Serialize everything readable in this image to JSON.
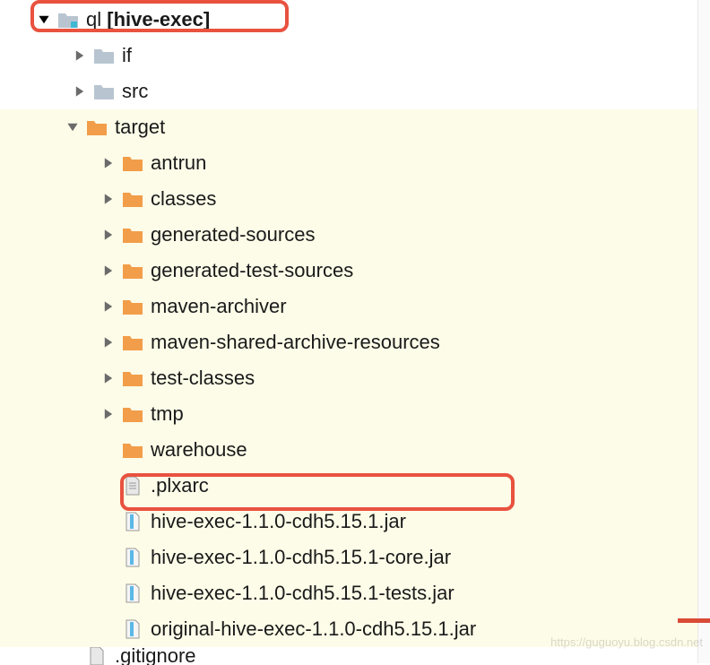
{
  "tree": {
    "root": {
      "name": "ql",
      "suffix": "[hive-exec]",
      "children": [
        {
          "name": "if",
          "icon": "folder-gray",
          "expandable": true
        },
        {
          "name": "src",
          "icon": "folder-gray",
          "expandable": true
        },
        {
          "name": "target",
          "icon": "folder-orange",
          "expanded": true,
          "children": [
            {
              "name": "antrun",
              "icon": "folder-orange",
              "expandable": true
            },
            {
              "name": "classes",
              "icon": "folder-orange",
              "expandable": true
            },
            {
              "name": "generated-sources",
              "icon": "folder-orange",
              "expandable": true
            },
            {
              "name": "generated-test-sources",
              "icon": "folder-orange",
              "expandable": true
            },
            {
              "name": "maven-archiver",
              "icon": "folder-orange",
              "expandable": true
            },
            {
              "name": "maven-shared-archive-resources",
              "icon": "folder-orange",
              "expandable": true
            },
            {
              "name": "test-classes",
              "icon": "folder-orange",
              "expandable": true
            },
            {
              "name": "tmp",
              "icon": "folder-orange",
              "expandable": true
            },
            {
              "name": "warehouse",
              "icon": "folder-orange",
              "expandable": false
            },
            {
              "name": ".plxarc",
              "icon": "file-text",
              "expandable": false
            },
            {
              "name": "hive-exec-1.1.0-cdh5.15.1.jar",
              "icon": "file-archive",
              "expandable": false
            },
            {
              "name": "hive-exec-1.1.0-cdh5.15.1-core.jar",
              "icon": "file-archive",
              "expandable": false
            },
            {
              "name": "hive-exec-1.1.0-cdh5.15.1-tests.jar",
              "icon": "file-archive",
              "expandable": false
            },
            {
              "name": "original-hive-exec-1.1.0-cdh5.15.1.jar",
              "icon": "file-archive",
              "expandable": false
            }
          ]
        },
        {
          "name": ".gitignore",
          "icon": "file-text",
          "expandable": false
        }
      ]
    }
  },
  "watermark": "https://guguoyu.blog.csdn.net"
}
